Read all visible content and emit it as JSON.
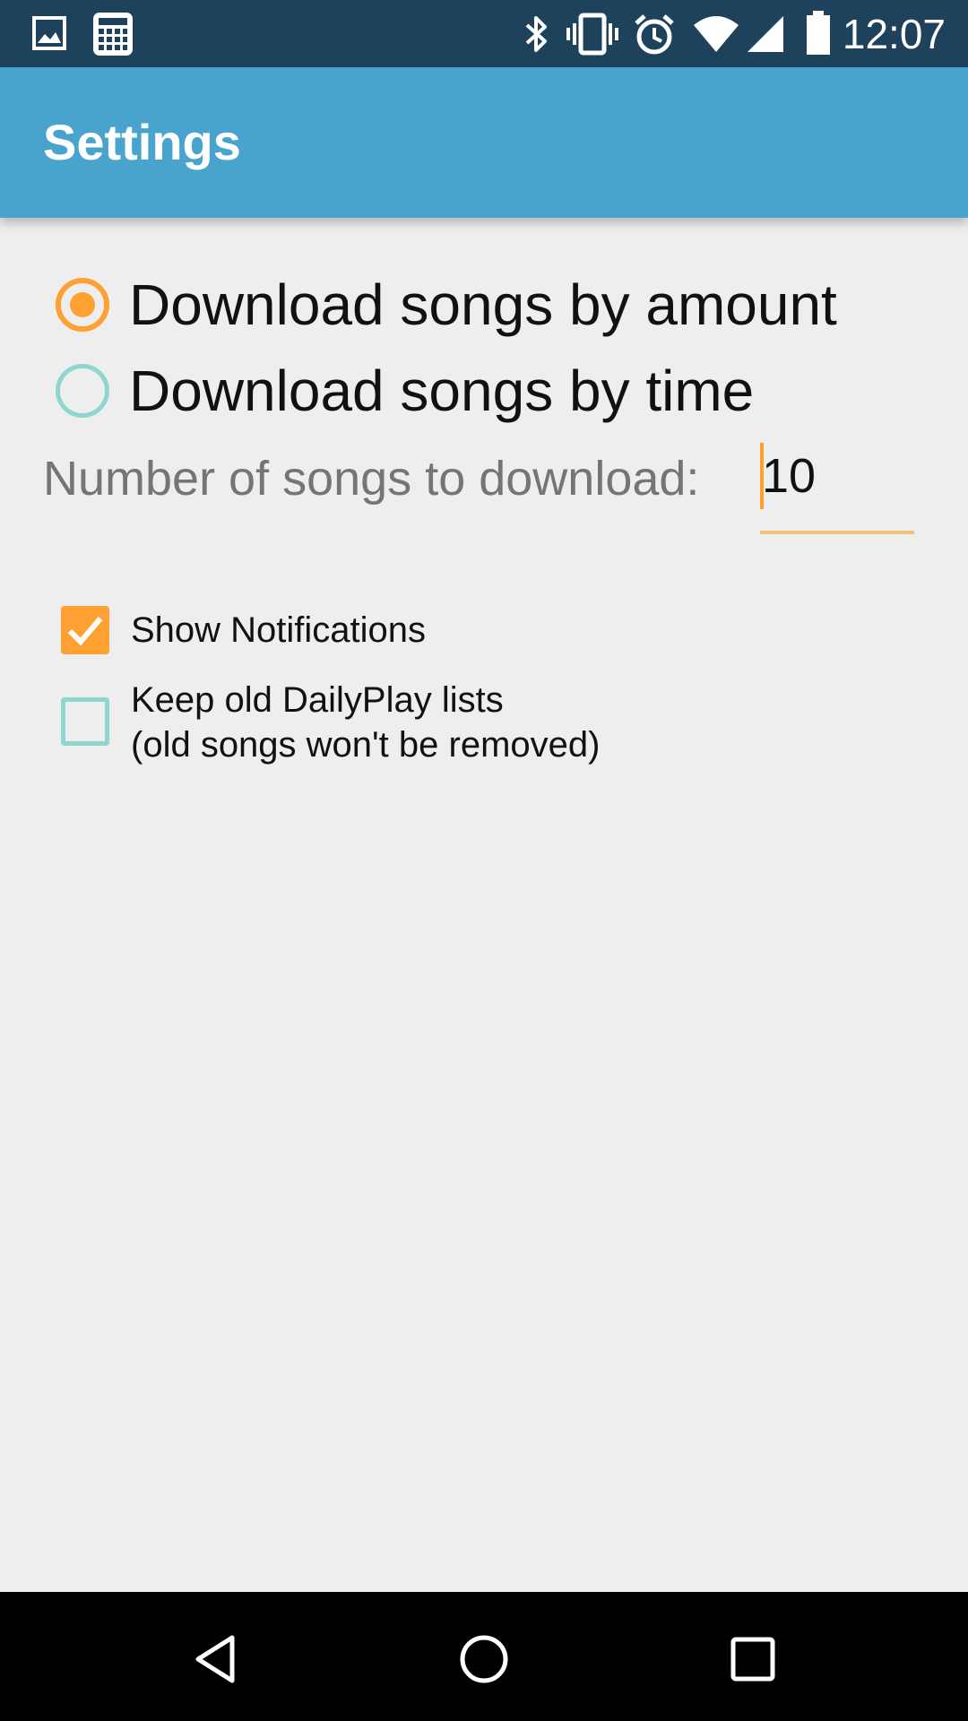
{
  "status_bar": {
    "time": "12:07",
    "left_icons": [
      "image-icon",
      "calculator-icon"
    ],
    "right_icons": [
      "bluetooth-icon",
      "vibrate-icon",
      "alarm-icon",
      "wifi-icon",
      "signal-icon",
      "battery-icon"
    ]
  },
  "app_bar": {
    "title": "Settings"
  },
  "download_mode": {
    "options": [
      {
        "label": "Download songs by amount",
        "selected": true
      },
      {
        "label": "Download songs by time",
        "selected": false
      }
    ]
  },
  "song_count": {
    "label": "Number of songs to download:",
    "value": "10"
  },
  "options": {
    "show_notifications": {
      "label": "Show Notifications",
      "checked": true
    },
    "keep_old_lists": {
      "label_line1": "Keep old DailyPlay lists",
      "label_line2": "(old songs won't be removed)",
      "checked": false
    }
  },
  "nav_bar": {
    "buttons": [
      "back-icon",
      "home-icon",
      "recents-icon"
    ]
  },
  "colors": {
    "status_bar": "#1f425c",
    "app_bar": "#48a4cc",
    "accent": "#ffa033",
    "unchecked": "#8fd6cf",
    "background": "#eeeeee"
  }
}
